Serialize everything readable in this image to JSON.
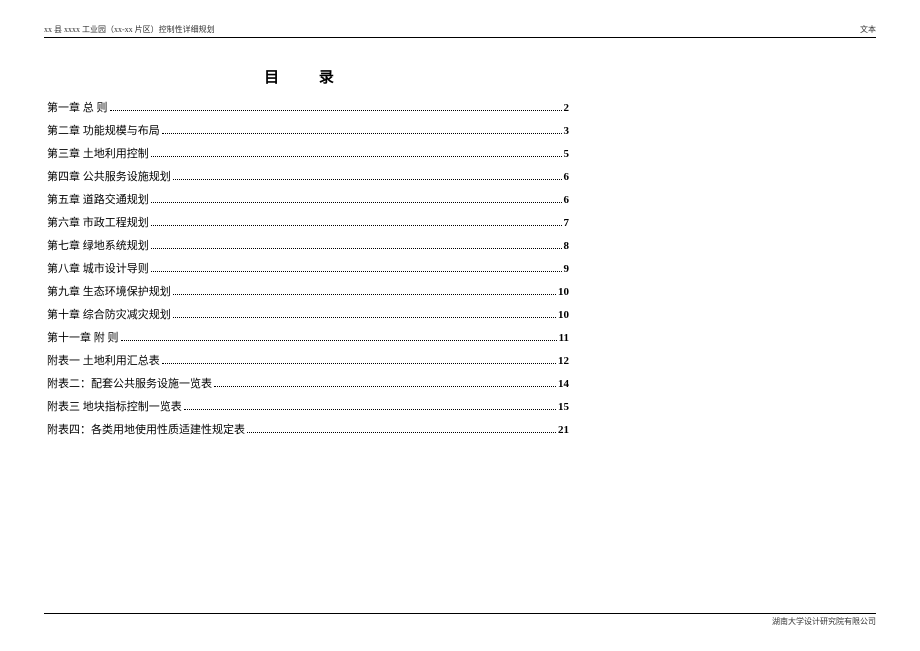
{
  "header": {
    "left": "xx 县 xxxx 工业园（xx-xx 片区）控制性详细规划",
    "right": "文本"
  },
  "toc": {
    "title": "目 录",
    "entries": [
      {
        "label": "第一章  总 则",
        "page": "2"
      },
      {
        "label": "第二章  功能规模与布局",
        "page": "3"
      },
      {
        "label": "第三章  土地利用控制",
        "page": "5"
      },
      {
        "label": "第四章  公共服务设施规划",
        "page": "6"
      },
      {
        "label": "第五章  道路交通规划",
        "page": "6"
      },
      {
        "label": "第六章  市政工程规划",
        "page": "7"
      },
      {
        "label": "第七章  绿地系统规划",
        "page": "8"
      },
      {
        "label": "第八章  城市设计导则",
        "page": "9"
      },
      {
        "label": "第九章  生态环境保护规划",
        "page": "10"
      },
      {
        "label": "第十章  综合防灾减灾规划",
        "page": "10"
      },
      {
        "label": "第十一章   附 则",
        "page": "11"
      },
      {
        "label": "附表一    土地利用汇总表",
        "page": "12"
      },
      {
        "label": "附表二：配套公共服务设施一览表",
        "page": "14"
      },
      {
        "label": "附表三   地块指标控制一览表",
        "page": "15"
      },
      {
        "label": "附表四：各类用地使用性质适建性规定表",
        "page": "21"
      }
    ]
  },
  "footer": {
    "text": "湖南大学设计研究院有限公司"
  }
}
